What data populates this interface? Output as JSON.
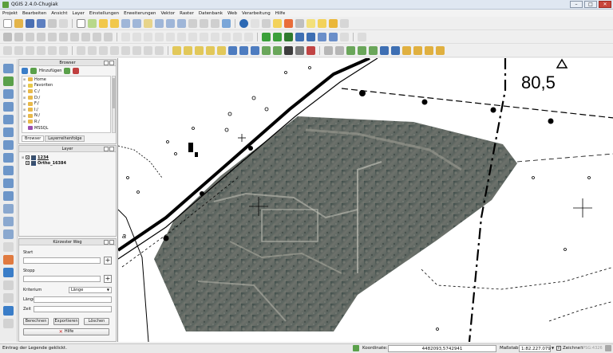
{
  "window": {
    "title": "QGIS 2.4.0-Chugiak",
    "buttons": [
      "–",
      "□",
      "✕"
    ]
  },
  "menubar": {
    "items": [
      "Projekt",
      "Bearbeiten",
      "Ansicht",
      "Layer",
      "Einstellungen",
      "Erweiterungen",
      "Vektor",
      "Raster",
      "Datenbank",
      "Web",
      "Verarbeitung",
      "Hilfe"
    ]
  },
  "browser_panel": {
    "title": "Browser",
    "add_label": "Hinzufügen",
    "items": [
      {
        "label": "Home",
        "icon": "home-folder-icon"
      },
      {
        "label": "Favoriten",
        "icon": "star-icon"
      },
      {
        "label": "C:/",
        "icon": "folder-icon"
      },
      {
        "label": "D:/",
        "icon": "folder-icon"
      },
      {
        "label": "F:/",
        "icon": "folder-icon"
      },
      {
        "label": "I:/",
        "icon": "folder-icon"
      },
      {
        "label": "N:/",
        "icon": "folder-icon"
      },
      {
        "label": "R:/",
        "icon": "folder-icon"
      },
      {
        "label": "MSSQL",
        "icon": "mssql-icon"
      }
    ],
    "tabs": [
      "Browser",
      "Layerreihenfolge"
    ]
  },
  "layers_panel": {
    "title": "Layer",
    "layers": [
      {
        "name": "1234",
        "checked": "✕"
      },
      {
        "name": "Ortho_16384",
        "checked": "✕"
      }
    ]
  },
  "shortest_path_panel": {
    "title": "Kürzester Weg",
    "start_label": "Start",
    "stop_label": "Stopp",
    "criterion_label": "Kriterium",
    "criterion_value": "Länge",
    "length_label": "Länge",
    "time_label": "Zeit",
    "add_symbol": "+",
    "buttons": {
      "calculate": "Berechnen",
      "export": "Exportieren",
      "delete": "Löschen",
      "help": "Hilfe"
    }
  },
  "map": {
    "label": "80,5"
  },
  "statusbar": {
    "message": "Eintrag der Legende geklickt.",
    "coordinate_label": "Koordinate:",
    "coordinate_value": "4482093,5742941",
    "scale_label": "Maßstab",
    "scale_value": "1:82.227.079",
    "render_label": "Zeichnen",
    "crs": "EPSG:4326"
  },
  "colors": {
    "accent": "#5c9f3d",
    "statusbar_bg": "#e9e9e9",
    "map_bg": "#ffffff"
  }
}
